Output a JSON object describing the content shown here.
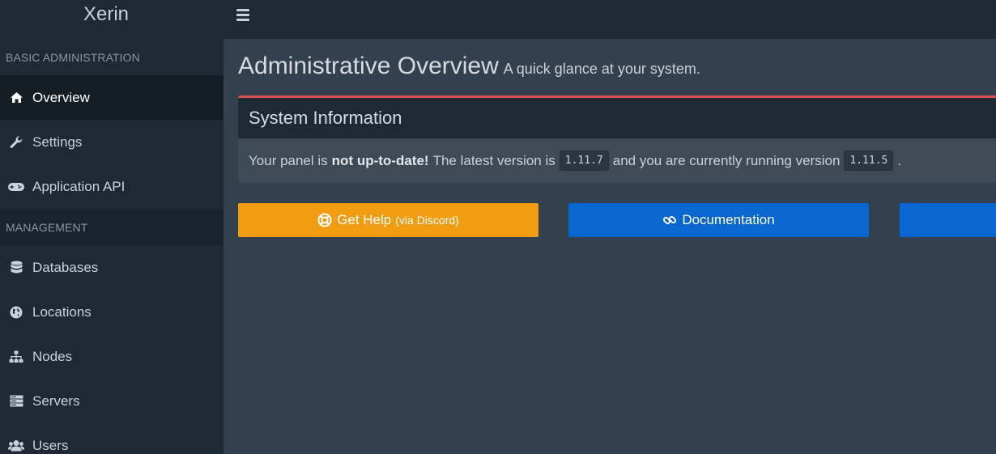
{
  "brand": "Xerin",
  "sidebar": {
    "sections": [
      {
        "header": "BASIC ADMINISTRATION"
      },
      {
        "header": "MANAGEMENT"
      }
    ],
    "items": [
      {
        "label": "Overview",
        "icon": "home-icon"
      },
      {
        "label": "Settings",
        "icon": "wrench-icon"
      },
      {
        "label": "Application API",
        "icon": "gamepad-icon"
      },
      {
        "label": "Databases",
        "icon": "database-icon"
      },
      {
        "label": "Locations",
        "icon": "globe-icon"
      },
      {
        "label": "Nodes",
        "icon": "sitemap-icon"
      },
      {
        "label": "Servers",
        "icon": "server-icon"
      },
      {
        "label": "Users",
        "icon": "users-icon"
      }
    ]
  },
  "page": {
    "title": "Administrative Overview",
    "subtitle": "A quick glance at your system."
  },
  "system_info": {
    "title": "System Information",
    "text_prefix": "Your panel is",
    "text_bold": "not up-to-date!",
    "text_middle": "The latest version is",
    "latest_version": "1.11.7",
    "text_after": "and you are currently running version",
    "current_version": "1.11.5",
    "text_end": "."
  },
  "buttons": {
    "help_label": "Get Help",
    "help_sub": "(via Discord)",
    "docs_label": "Documentation"
  },
  "colors": {
    "help_button": "#f29c11",
    "docs_button": "#0967d2",
    "box_accent": "#d9534f",
    "sidebar_bg": "#1f2933",
    "content_bg": "#33404d"
  }
}
